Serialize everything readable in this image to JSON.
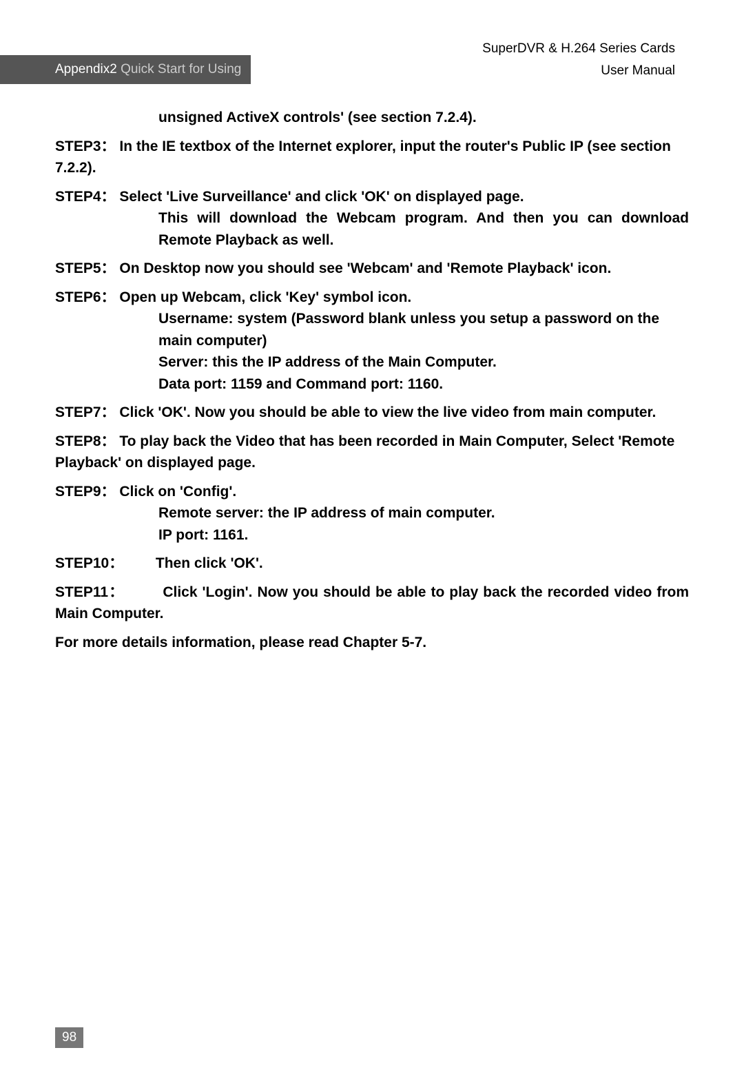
{
  "header": {
    "product": "SuperDVR & H.264 Series Cards",
    "doc_type": "User  Manual"
  },
  "appendix": {
    "label": "Appendix2",
    "title": " Quick Start for Using"
  },
  "first_line": "unsigned ActiveX controls' (see section 7.2.4).",
  "steps": {
    "s3": {
      "label": "STEP3：",
      "text": "In the IE textbox of the Internet explorer, input the router's Public IP (see section 7.2.2)."
    },
    "s4": {
      "label": "STEP4：",
      "line1": "Select 'Live Surveillance' and click 'OK' on displayed page.",
      "line2": "This will download the Webcam program. And then you can download Remote Playback as well."
    },
    "s5": {
      "label": "STEP5：",
      "text": "On Desktop now you should see 'Webcam' and 'Remote Playback' icon."
    },
    "s6": {
      "label": "STEP6：",
      "line1": "Open up Webcam, click 'Key' symbol icon.",
      "line2": "Username: system (Password blank unless you setup a password on the main computer)",
      "line3": "Server: this the IP address of the Main Computer.",
      "line4": "Data port: 1159 and Command port: 1160."
    },
    "s7": {
      "label": "STEP7：",
      "text": "Click 'OK'. Now you should be able to view the live video from main computer."
    },
    "s8": {
      "label": "STEP8：",
      "text": "To play back the Video that has been recorded in Main Computer, Select 'Remote Playback' on displayed page."
    },
    "s9": {
      "label": "STEP9：",
      "line1": "Click on 'Config'.",
      "line2": "Remote server: the IP address of main computer.",
      "line3": "IP port: 1161."
    },
    "s10": {
      "label": "STEP10：",
      "text": "Then click 'OK'."
    },
    "s11": {
      "label": "STEP11：",
      "text": "Click 'Login'. Now you should be able to play back the recorded video from Main Computer."
    },
    "footer": "For more details information, please read Chapter 5-7."
  },
  "page_number": "98"
}
